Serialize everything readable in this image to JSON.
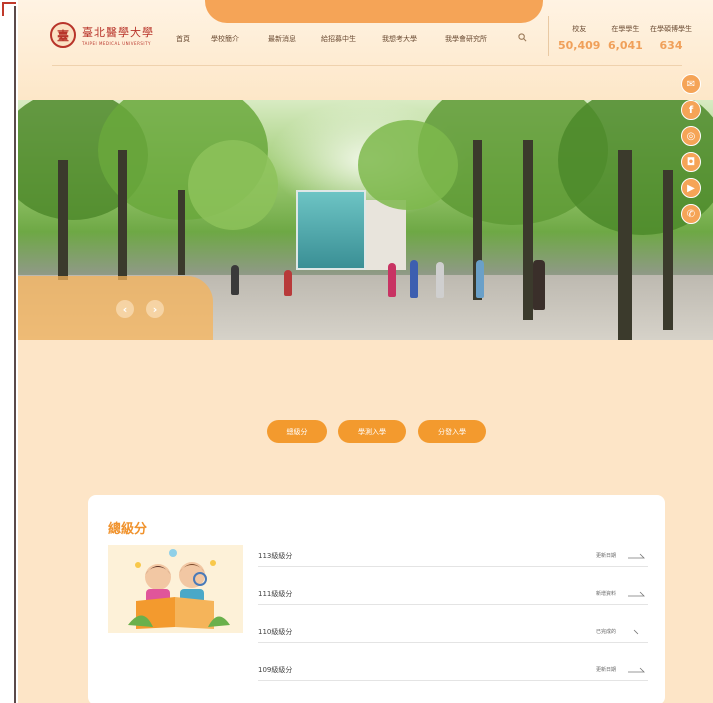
{
  "logo": {
    "seal": "臺",
    "cn": "臺北醫學大學",
    "en": "TAIPEI MEDICAL UNIVERSITY"
  },
  "nav": {
    "items": [
      "首頁",
      "學校簡介",
      "最新消息",
      "給招募中生",
      "我想考大學",
      "我學會研究所"
    ]
  },
  "stats": [
    {
      "label": "校友",
      "value": "50,409"
    },
    {
      "label": "在學學生",
      "value": "6,041"
    },
    {
      "label": "在學碩博學生",
      "value": "634"
    }
  ],
  "hero": {
    "prev": "‹",
    "next": "›"
  },
  "social": [
    {
      "name": "mail-icon",
      "glyph": "✉"
    },
    {
      "name": "facebook-icon",
      "glyph": "f"
    },
    {
      "name": "line-icon",
      "glyph": "◎"
    },
    {
      "name": "instagram-icon",
      "glyph": "◘"
    },
    {
      "name": "youtube-icon",
      "glyph": "▶"
    },
    {
      "name": "phone-icon",
      "glyph": "✆"
    }
  ],
  "pills": [
    "總級分",
    "學測入學",
    "分發入學"
  ],
  "card": {
    "title": "總級分",
    "rows": [
      {
        "title": "113級級分",
        "meta": "更新日期"
      },
      {
        "title": "111級級分",
        "meta": "新增資料"
      },
      {
        "title": "110級級分",
        "meta": "已完成的"
      },
      {
        "title": "109級級分",
        "meta": "更新日期"
      }
    ]
  },
  "colors": {
    "accent": "#f5a457",
    "pill": "#f39a2e",
    "title": "#f0922c",
    "bg": "#fde5c7"
  }
}
